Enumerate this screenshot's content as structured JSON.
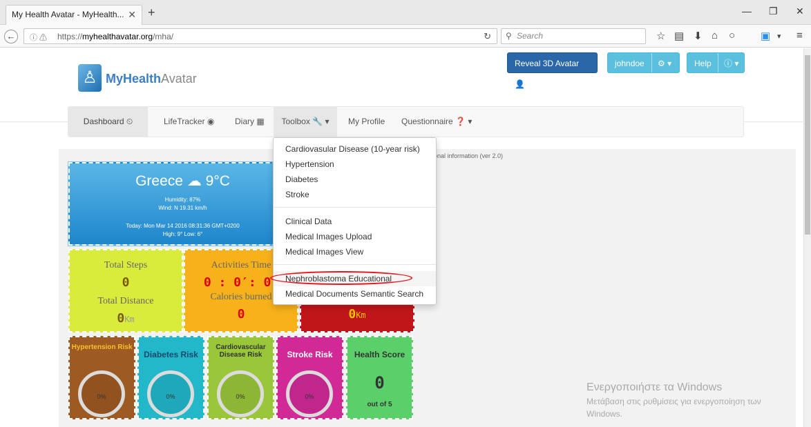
{
  "browser": {
    "tab_title": "My Health Avatar - MyHealth...",
    "url_prefix": "https://",
    "url_host": "myhealthavatar.org",
    "url_path": "/mha/",
    "search_placeholder": "Search"
  },
  "site": {
    "logo_bold": "MyHealth",
    "logo_light": "Avatar"
  },
  "top_buttons": {
    "reveal": "Reveal 3D Avatar",
    "user": "johndoe",
    "help": "Help"
  },
  "nav": {
    "dashboard": "Dashboard",
    "lifetracker": "LifeTracker",
    "diary": "Diary",
    "toolbox": "Toolbox",
    "my_profile": "My Profile",
    "questionnaire": "Questionnaire"
  },
  "version_text": "onal information (ver 2.0)",
  "weather": {
    "title": "Greece",
    "temp": "9°C",
    "humidity": "Humidity: 87%",
    "wind": "Wind: N 19.31 km/h",
    "today": "Today: Mon Mar 14 2016 08:31:36 GMT+0200",
    "highlow": "High: 9° Low: 6°"
  },
  "steps_tile": {
    "steps_label": "Total Steps",
    "steps_value": "0",
    "distance_label": "Total Distance",
    "distance_value": "0",
    "distance_unit": "Km"
  },
  "activity_tile": {
    "time_label": "Activities Time",
    "time_value": "0 : 0′: 0″",
    "calories_label": "Calories burned",
    "calories_value": "0"
  },
  "red_tile": {
    "value": "0",
    "unit": "Km"
  },
  "risks": {
    "hypertension": {
      "title": "Hypertension Risk",
      "pct": "0%"
    },
    "diabetes": {
      "title": "Diabetes Risk",
      "pct": "0%"
    },
    "cardio": {
      "title": "Cardiovascular Disease Risk",
      "pct": "0%"
    },
    "stroke": {
      "title": "Stroke Risk",
      "pct": "0%"
    },
    "health_score": {
      "title": "Health Score",
      "value": "0",
      "sub": "out of 5"
    }
  },
  "toolbox_menu": {
    "items": [
      "Cardiovasular Disease (10-year risk)",
      "Hypertension",
      "Diabetes",
      "Stroke",
      "Clinical Data",
      "Medical Images Upload",
      "Medical Images View",
      "Nephroblastoma Educational",
      "Medical Documents Semantic Search"
    ]
  },
  "watermark": {
    "line1": "Ενεργοποιήστε τα Windows",
    "line2": "Μετάβαση στις ρυθμίσεις για ενεργοποίηση των",
    "line3": "Windows."
  },
  "colors": {
    "primary": "#2a67a8",
    "info": "#5bc0de",
    "annotation": "#e4151f"
  }
}
